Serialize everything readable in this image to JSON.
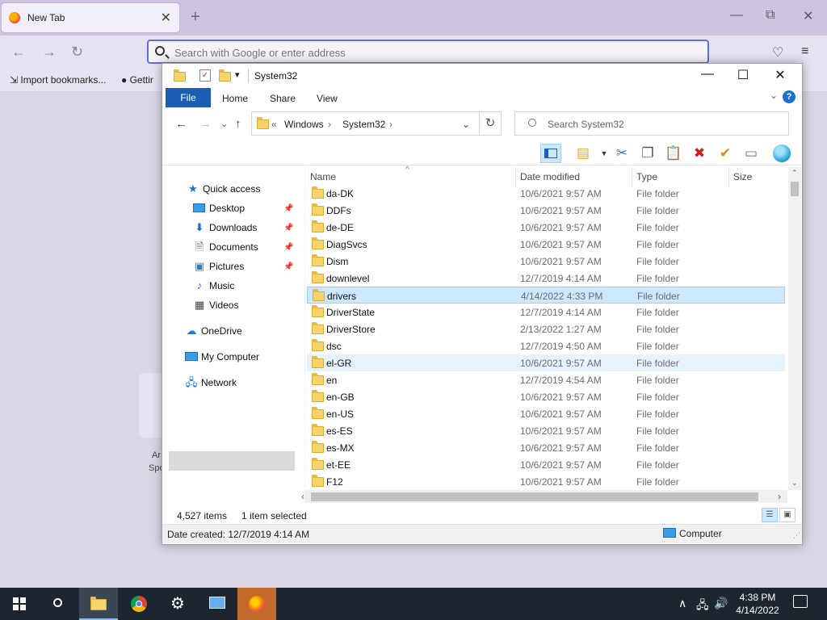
{
  "browser": {
    "tab_title": "New Tab",
    "tab_close": "✕",
    "new_tab": "+",
    "window_controls": {
      "minimize": "—",
      "restore": "⧉",
      "close": "✕"
    },
    "nav": {
      "back": "←",
      "forward": "→",
      "reload": "↻"
    },
    "address_placeholder": "Search with Google or enter address",
    "bookmarks": [
      {
        "label": "Import bookmarks..."
      },
      {
        "label": "Gettir"
      }
    ],
    "tile_text": [
      "Ar",
      "Spo"
    ]
  },
  "explorer": {
    "title": "System32",
    "quick_access_chevron": "▾",
    "title_controls": {
      "minimize": "—",
      "maximize": "☐",
      "close": "✕"
    },
    "ribbon_tabs": [
      "File",
      "Home",
      "Share",
      "View"
    ],
    "ribbon_expand": "⌄",
    "help": "?",
    "nav_buttons": {
      "back": "←",
      "forward": "→",
      "recent": "⌄",
      "up": "↑"
    },
    "breadcrumb_prefix": "«",
    "breadcrumb": [
      "Windows",
      "System32"
    ],
    "breadcrumb_sep": "›",
    "address_dropdown": "⌄",
    "refresh": "↻",
    "search_placeholder": "Search System32",
    "nav_pane": {
      "quick_access": "Quick access",
      "items": [
        {
          "label": "Desktop",
          "pinned": true
        },
        {
          "label": "Downloads",
          "pinned": true
        },
        {
          "label": "Documents",
          "pinned": true
        },
        {
          "label": "Pictures",
          "pinned": true
        },
        {
          "label": "Music",
          "pinned": false
        },
        {
          "label": "Videos",
          "pinned": false
        }
      ],
      "onedrive": "OneDrive",
      "my_computer": "My Computer",
      "network": "Network",
      "pin_glyph": "📌"
    },
    "columns": [
      "Name",
      "Date modified",
      "Type",
      "Size"
    ],
    "sort_arrow": "^",
    "files": [
      {
        "name": "da-DK",
        "date": "10/6/2021 9:57 AM",
        "type": "File folder"
      },
      {
        "name": "DDFs",
        "date": "10/6/2021 9:57 AM",
        "type": "File folder"
      },
      {
        "name": "de-DE",
        "date": "10/6/2021 9:57 AM",
        "type": "File folder"
      },
      {
        "name": "DiagSvcs",
        "date": "10/6/2021 9:57 AM",
        "type": "File folder"
      },
      {
        "name": "Dism",
        "date": "10/6/2021 9:57 AM",
        "type": "File folder"
      },
      {
        "name": "downlevel",
        "date": "12/7/2019 4:14 AM",
        "type": "File folder"
      },
      {
        "name": "drivers",
        "date": "4/14/2022 4:33 PM",
        "type": "File folder",
        "selected": true
      },
      {
        "name": "DriverState",
        "date": "12/7/2019 4:14 AM",
        "type": "File folder"
      },
      {
        "name": "DriverStore",
        "date": "2/13/2022 1:27 AM",
        "type": "File folder"
      },
      {
        "name": "dsc",
        "date": "12/7/2019 4:50 AM",
        "type": "File folder"
      },
      {
        "name": "el-GR",
        "date": "10/6/2021 9:57 AM",
        "type": "File folder",
        "hover": true
      },
      {
        "name": "en",
        "date": "12/7/2019 4:54 AM",
        "type": "File folder"
      },
      {
        "name": "en-GB",
        "date": "10/6/2021 9:57 AM",
        "type": "File folder"
      },
      {
        "name": "en-US",
        "date": "10/6/2021 9:57 AM",
        "type": "File folder"
      },
      {
        "name": "es-ES",
        "date": "10/6/2021 9:57 AM",
        "type": "File folder"
      },
      {
        "name": "es-MX",
        "date": "10/6/2021 9:57 AM",
        "type": "File folder"
      },
      {
        "name": "et-EE",
        "date": "10/6/2021 9:57 AM",
        "type": "File folder"
      },
      {
        "name": "F12",
        "date": "10/6/2021 9:57 AM",
        "type": "File folder"
      }
    ],
    "scroll_glyphs": {
      "up": "⌃",
      "down": "⌄",
      "left": "‹",
      "right": "›"
    },
    "status": {
      "item_count": "4,527 items",
      "selection": "1 item selected"
    },
    "details_bar": {
      "text": "Date created: 12/7/2019 4:14 AM",
      "location": "Computer"
    },
    "view_glyphs": {
      "details": "☰",
      "thumbs": "▣"
    },
    "grip": "⋰"
  },
  "taskbar": {
    "time": "4:38 PM",
    "date": "4/14/2022",
    "tray": {
      "up": "∧",
      "network": "🖧",
      "volume": "🔊"
    }
  },
  "colors": {
    "accent": "#1a5fb4",
    "selection": "#cce8ff",
    "taskbar": "#1c2530",
    "folder": "#f7d46a"
  }
}
